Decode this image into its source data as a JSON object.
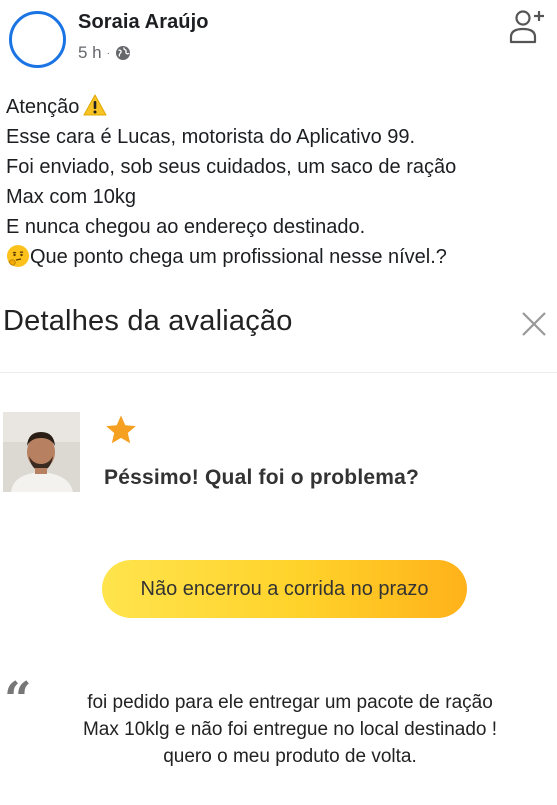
{
  "post": {
    "author": "Soraia Araújo",
    "time": "5 h",
    "separator": "·",
    "lines": [
      "Atenção",
      "Esse cara é Lucas, motorista do Aplicativo 99.",
      "Foi enviado, sob seus cuidados, um saco de ração",
      "Max com 10kg",
      "E nunca chegou ao endereço destinado.",
      "Que ponto chega um profissional  nesse nível.?"
    ],
    "icons": {
      "privacy": "globe-icon",
      "action": "add-friend-icon",
      "emoji_1": "warning-icon",
      "emoji_2": "thinking-face-icon"
    }
  },
  "review": {
    "title": "Detalhes da avaliação",
    "rating_stars": 1,
    "rating_text": "Péssimo! Qual foi o problema?",
    "problem_tag": "Não encerrou a corrida no prazo",
    "comment_lines": [
      "foi pedido para ele entregar um pacote de ração",
      "Max 10klg e não foi entregue no local destinado !",
      "quero o meu produto de volta."
    ],
    "icons": {
      "close": "close-icon",
      "star": "star-icon",
      "quote": "quote-icon"
    }
  },
  "colors": {
    "avatar_ring": "#1b74e4",
    "star": "#f5a020",
    "chip_start": "#ffe44d",
    "chip_end": "#ffb21a",
    "secondary_text": "#65676b"
  }
}
